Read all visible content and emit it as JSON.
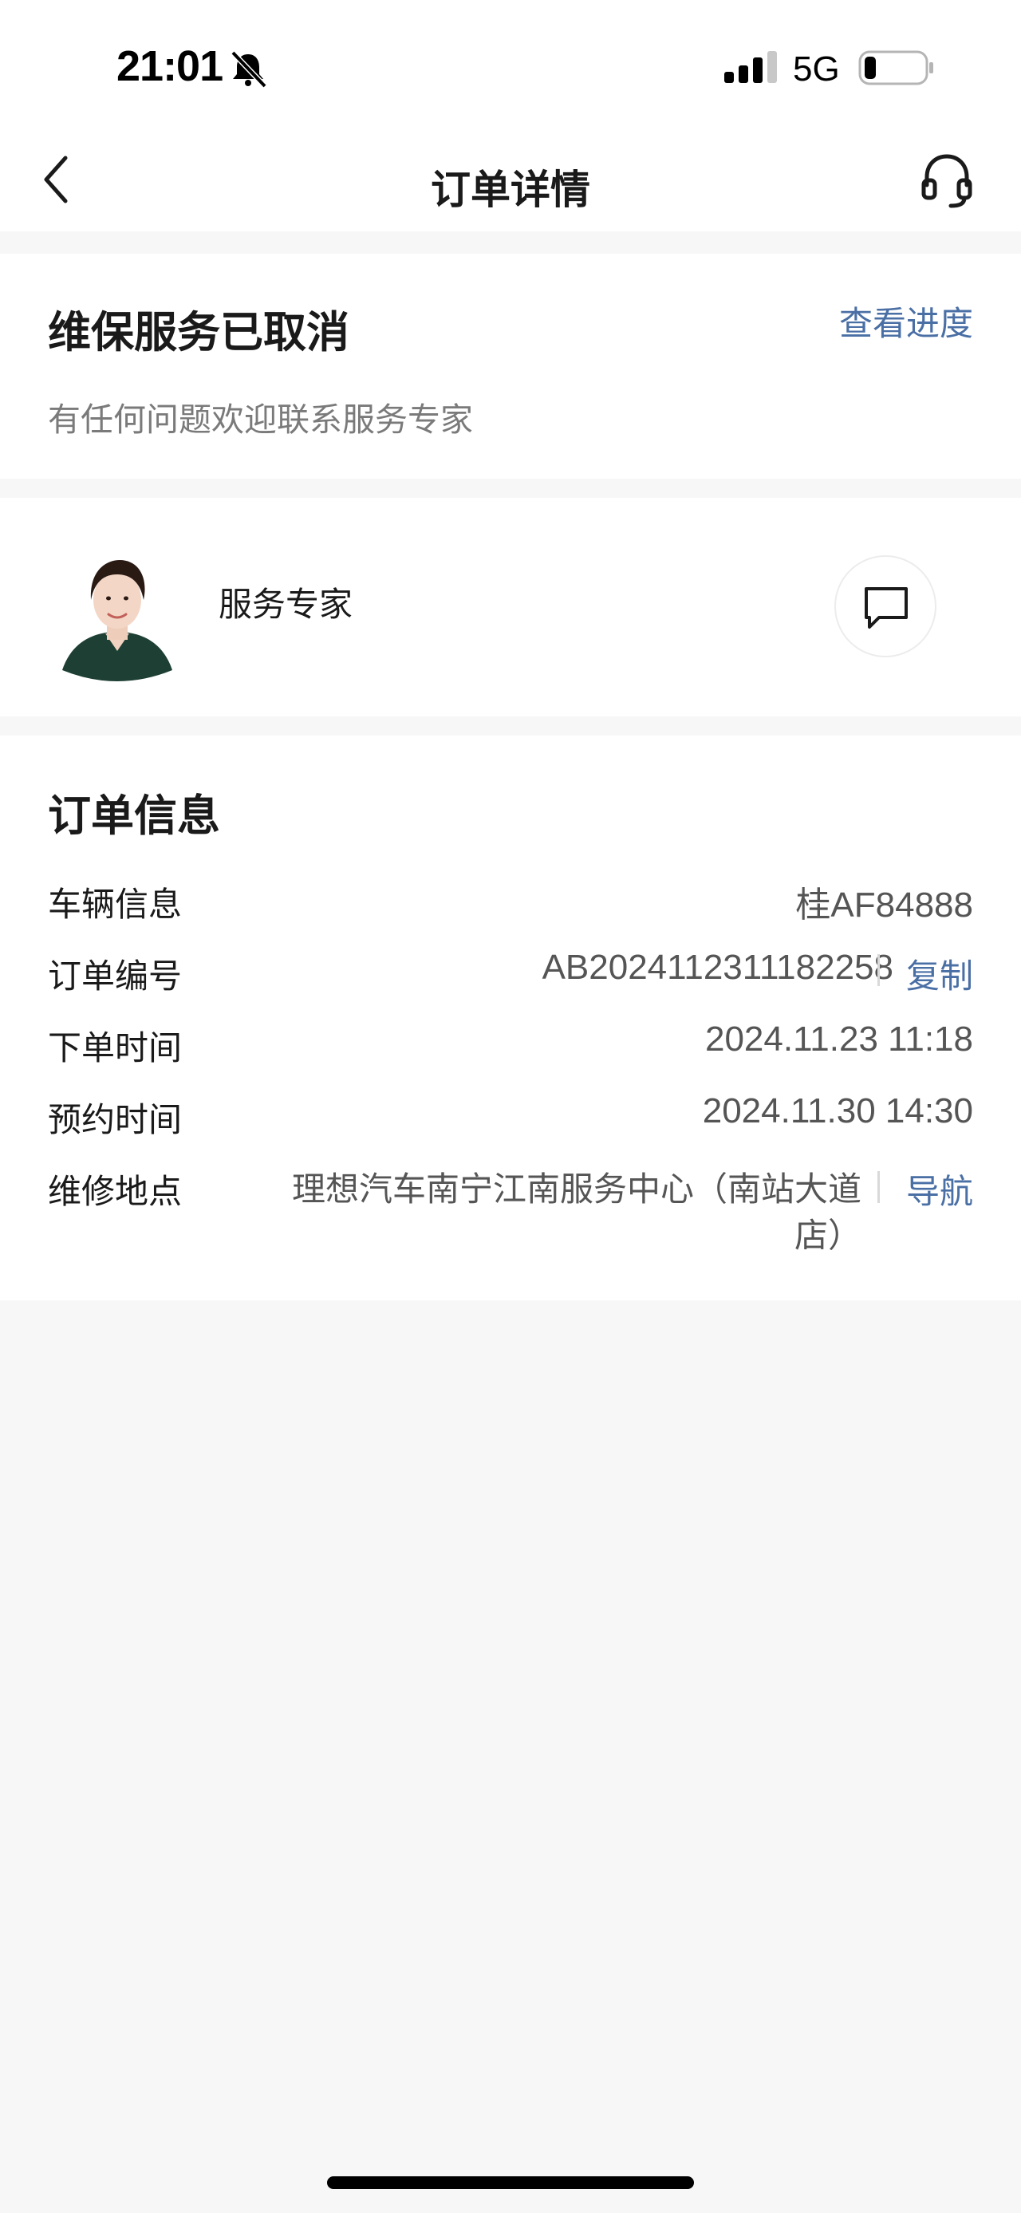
{
  "status_bar": {
    "time": "21:01",
    "network": "5G",
    "icons": [
      "bell-slash-icon",
      "signal-icon",
      "battery-icon"
    ]
  },
  "nav": {
    "title": "订单详情",
    "icons": [
      "back-icon",
      "headset-icon"
    ]
  },
  "status_card": {
    "title": "维保服务已取消",
    "link": "查看进度",
    "subtitle": "有任何问题欢迎联系服务专家"
  },
  "expert": {
    "name": "服务专家",
    "icons": [
      "avatar",
      "chat-icon"
    ]
  },
  "order": {
    "title": "订单信息",
    "rows": [
      {
        "label": "车辆信息",
        "value": "桂AF84888"
      },
      {
        "label": "订单编号",
        "value": "AB2024112311182258",
        "action": "复制"
      },
      {
        "label": "下单时间",
        "value": "2024.11.23 11:18"
      },
      {
        "label": "预约时间",
        "value": "2024.11.30 14:30"
      },
      {
        "label": "维修地点",
        "value": "理想汽车南宁江南服务中心（南站大道店）",
        "action": "导航"
      }
    ]
  },
  "colors": {
    "accent": "#4a6fa5",
    "background": "#f7f7f7",
    "card": "#ffffff"
  }
}
